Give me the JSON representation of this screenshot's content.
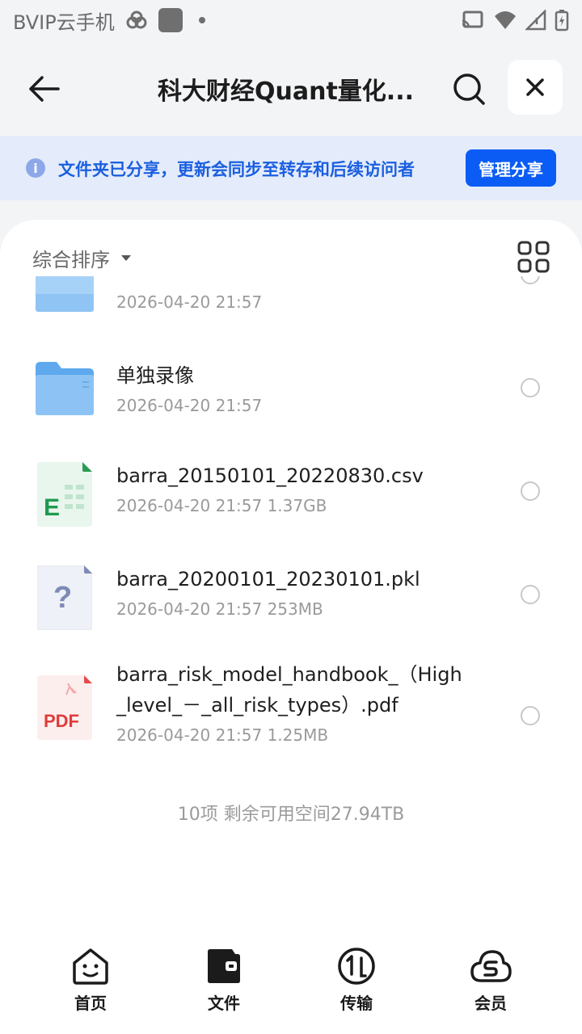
{
  "status_bar": {
    "carrier": "BVIP云手机"
  },
  "header": {
    "title": "科大财经Quant量化..."
  },
  "banner": {
    "text": "文件夹已分享，更新会同步至转存和后续访问者",
    "button": "管理分享",
    "info_glyph": "i"
  },
  "toolbar": {
    "sort_label": "综合排序"
  },
  "files": [
    {
      "name": "",
      "meta": "2026-04-20 21:57",
      "icon": "folder-icon"
    },
    {
      "name": "单独录像",
      "meta": "2026-04-20 21:57",
      "icon": "folder-icon"
    },
    {
      "name": "barra_20150101_20220830.csv",
      "meta": "2026-04-20 21:57  1.37GB",
      "icon": "spreadsheet-icon",
      "badge": "E"
    },
    {
      "name": "barra_20200101_20230101.pkl",
      "meta": "2026-04-20 21:57  253MB",
      "icon": "unknown-file-icon",
      "badge": "?"
    },
    {
      "name_line1": "barra_risk_model_handbook_（High",
      "name_line2": "_level_－_all_risk_types）.pdf",
      "meta": "2026-04-20 21:57  1.25MB",
      "icon": "pdf-icon",
      "badge": "PDF"
    }
  ],
  "summary": "10项 剩余可用空间27.94TB",
  "tabs": [
    {
      "label": "首页",
      "icon": "home-face-icon"
    },
    {
      "label": "文件",
      "icon": "wallet-folder-icon"
    },
    {
      "label": "传输",
      "icon": "transfer-icon"
    },
    {
      "label": "会员",
      "icon": "vip-cloud-icon"
    }
  ],
  "colors": {
    "accent": "#0a5cf5",
    "banner_bg": "#e4ecfb",
    "banner_text": "#1b5fe0"
  }
}
